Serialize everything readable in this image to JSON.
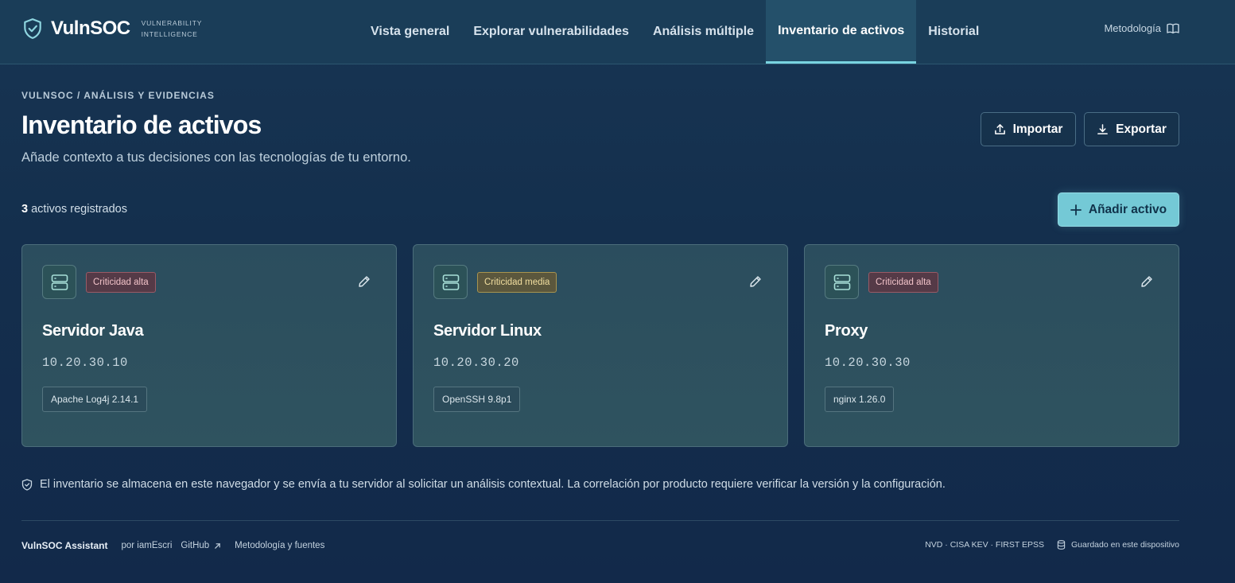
{
  "brand": {
    "name": "VulnSOC",
    "tag_line1": "VULNERABILITY",
    "tag_line2": "INTELLIGENCE"
  },
  "nav": {
    "items": [
      {
        "label": "Vista general"
      },
      {
        "label": "Explorar vulnerabilidades"
      },
      {
        "label": "Análisis múltiple"
      },
      {
        "label": "Inventario de activos"
      },
      {
        "label": "Historial"
      }
    ],
    "active": "Inventario de activos",
    "methodology_label": "Metodología"
  },
  "page": {
    "breadcrumb": "VULNSOC / ANÁLISIS Y EVIDENCIAS",
    "title": "Inventario de activos",
    "subtitle": "Añade contexto a tus decisiones con las tecnologías de tu entorno.",
    "import_label": "Importar",
    "export_label": "Exportar",
    "count_value": "3",
    "count_text": "activos registrados",
    "add_label": "Añadir activo"
  },
  "assets": [
    {
      "criticality": "Criticidad alta",
      "level": "high",
      "name": "Servidor Java",
      "ip": "10.20.30.10",
      "tech": "Apache Log4j 2.14.1"
    },
    {
      "criticality": "Criticidad media",
      "level": "medium",
      "name": "Servidor Linux",
      "ip": "10.20.30.20",
      "tech": "OpenSSH 9.8p1"
    },
    {
      "criticality": "Criticidad alta",
      "level": "high",
      "name": "Proxy",
      "ip": "10.20.30.30",
      "tech": "nginx 1.26.0"
    }
  ],
  "notice": "El inventario se almacena en este navegador y se envía a tu servidor al solicitar un análisis contextual. La correlación por producto requiere verificar la versión y la configuración.",
  "footer": {
    "brand": "VulnSOC Assistant",
    "by": "por iamEscri",
    "github": "GitHub",
    "methodology": "Metodología y fuentes",
    "sources": "NVD · CISA KEV · FIRST EPSS",
    "storage": "Guardado en este dispositivo"
  },
  "colors": {
    "accent": "#74c9d6",
    "critical_high": "#9a5a66",
    "critical_medium": "#a8944f",
    "background": "#142f4d"
  }
}
